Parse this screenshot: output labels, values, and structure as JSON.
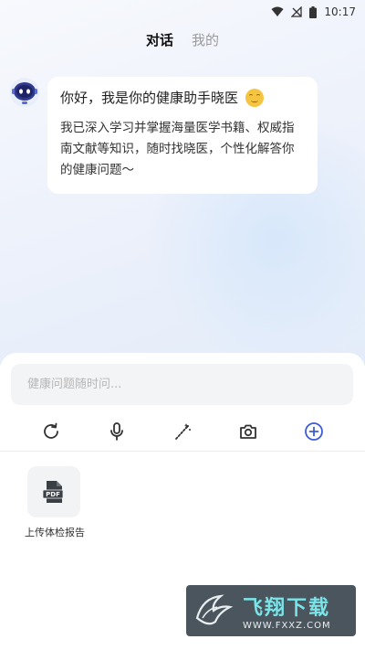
{
  "status_bar": {
    "time": "10:17"
  },
  "tabs": [
    {
      "label": "对话",
      "active": true
    },
    {
      "label": "我的",
      "active": false
    }
  ],
  "message": {
    "title": "你好，我是你的健康助手晓医",
    "body": "我已深入学习并掌握海量医学书籍、权威指南文献等知识，随时找晓医，个性化解答你的健康问题～"
  },
  "input": {
    "placeholder": "健康问题随时问..."
  },
  "toolbar": {
    "icons": [
      "refresh-icon",
      "microphone-icon",
      "magic-wand-icon",
      "camera-icon",
      "add-icon"
    ],
    "accent_color": "#3b5bdb"
  },
  "attachments": [
    {
      "icon": "pdf-icon",
      "icon_text": "PDF",
      "label": "上传体检报告"
    }
  ],
  "watermark": {
    "title": "飞翔下载",
    "url": "WWW.FXXZ.COM"
  }
}
